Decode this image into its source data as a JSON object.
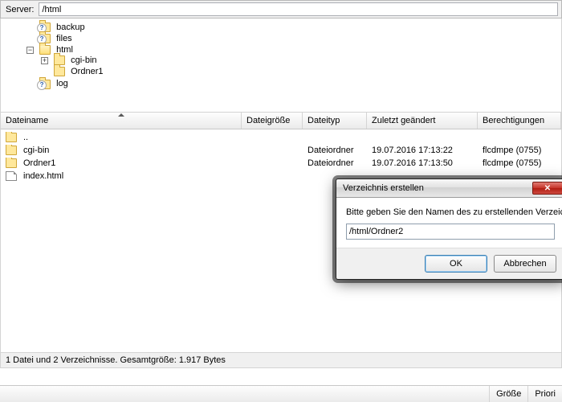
{
  "server_bar": {
    "label": "Server:",
    "path": "/html"
  },
  "tree": {
    "items": [
      {
        "name": "backup",
        "expander": "",
        "icon": "qmark"
      },
      {
        "name": "files",
        "expander": "",
        "icon": "qmark"
      },
      {
        "name": "html",
        "expander": "−",
        "icon": "open",
        "children": [
          {
            "name": "cgi-bin",
            "expander": "+",
            "icon": "folder"
          },
          {
            "name": "Ordner1",
            "expander": "",
            "icon": "folder"
          }
        ]
      },
      {
        "name": "log",
        "expander": "",
        "icon": "qmark"
      }
    ]
  },
  "columns": {
    "name": "Dateiname",
    "size": "Dateigröße",
    "type": "Dateityp",
    "modified": "Zuletzt geändert",
    "perm": "Berechtigungen"
  },
  "rows": [
    {
      "icon": "folder",
      "name": "..",
      "size": "",
      "type": "",
      "modified": "",
      "perm": ""
    },
    {
      "icon": "folder",
      "name": "cgi-bin",
      "size": "",
      "type": "Dateiordner",
      "modified": "19.07.2016 17:13:22",
      "perm": "flcdmpe (0755)"
    },
    {
      "icon": "folder",
      "name": "Ordner1",
      "size": "",
      "type": "Dateiordner",
      "modified": "19.07.2016 17:13:50",
      "perm": "flcdmpe (0755)"
    },
    {
      "icon": "file",
      "name": "index.html",
      "size": "",
      "type": "",
      "modified": "",
      "perm": ""
    }
  ],
  "status": "1 Datei und 2 Verzeichnisse. Gesamtgröße: 1.917 Bytes",
  "bottom": {
    "size": "Größe",
    "prio": "Priori"
  },
  "dialog": {
    "title": "Verzeichnis erstellen",
    "prompt": "Bitte geben Sie den Namen des zu erstellenden Verzeichnisses ein:",
    "value": "/html/Ordner2",
    "ok": "OK",
    "cancel": "Abbrechen"
  }
}
